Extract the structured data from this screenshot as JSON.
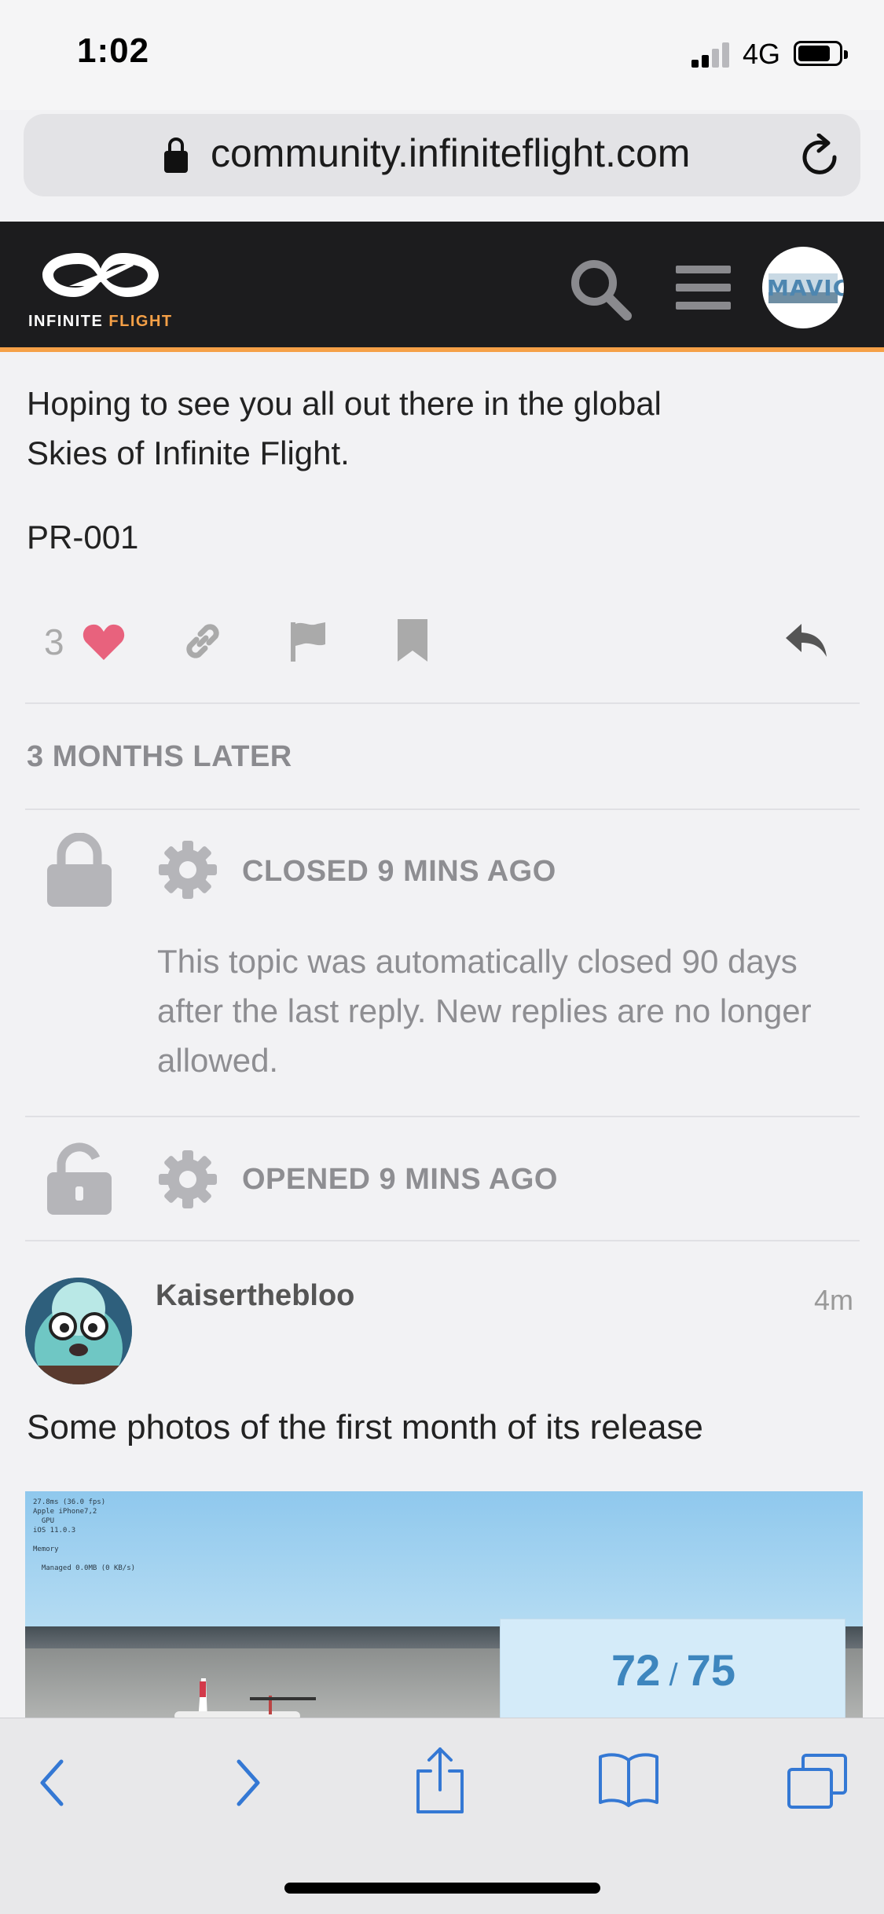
{
  "status_bar": {
    "time": "1:02",
    "network": "4G"
  },
  "browser": {
    "url": "community.infiniteflight.com"
  },
  "site_header": {
    "logo_word1": "INFINITE",
    "logo_word2": "FLIGHT",
    "avatar_text": "MAVIC"
  },
  "post_tail": {
    "line1": "Hoping to see you all out there in the global",
    "line2": "Skies of Infinite Flight.",
    "signature": "PR-001",
    "like_count": "3"
  },
  "time_gap": "3 MONTHS LATER",
  "events": [
    {
      "title": "CLOSED 9 MINS AGO",
      "body": "This topic was automatically closed 90 days after the last reply. New replies are no longer allowed."
    },
    {
      "title": "OPENED 9 MINS AGO"
    }
  ],
  "reply": {
    "username": "Kaiserthebloo",
    "time": "4m",
    "text": "Some photos of the first month of its release",
    "image_hud": "27.8ms (36.0 fps)\nApple iPhone7,2\n  GPU\niOS 11.0.3\n\nMemory\n\n  Managed 0.0MB (0 KB/s)"
  },
  "progress": {
    "current": "72",
    "total": "75"
  },
  "colors": {
    "accent": "#f5a047",
    "like": "#e8627d",
    "link_blue": "#3478d4",
    "header_bg": "#1c1c1e"
  }
}
